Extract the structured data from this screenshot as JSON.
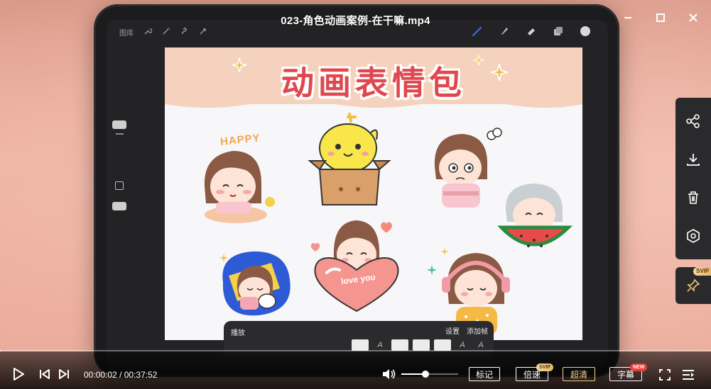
{
  "window": {
    "title": "023-角色动画案例-在干嘛.mp4"
  },
  "ipad_app": {
    "toolbar_left_label": "图库",
    "canvas": {
      "banner_title": "动画表情包",
      "happy_text": "HAPPY",
      "love_text": "love you"
    },
    "animation_panel": {
      "play_label": "播放",
      "settings_label": "设置",
      "add_frame_label": "添加帧"
    }
  },
  "side_panel": {
    "items": [
      "share-icon",
      "download-icon",
      "trash-icon",
      "eye-icon"
    ],
    "pin_badge": "SVIP"
  },
  "player": {
    "current_time": "00:00:02",
    "separator": "/",
    "total_time": "00:37:52",
    "progress": 0.001,
    "volume": 0.42,
    "buttons": {
      "bookmark": "标记",
      "speed": "倍速",
      "speed_badge": "SVIP",
      "quality": "超清",
      "subtitle": "字幕",
      "subtitle_badge": "NEW"
    }
  },
  "colors": {
    "accent_gold": "#f3d18a",
    "banner_red": "#e0484f",
    "badge_red": "#e8413c"
  }
}
